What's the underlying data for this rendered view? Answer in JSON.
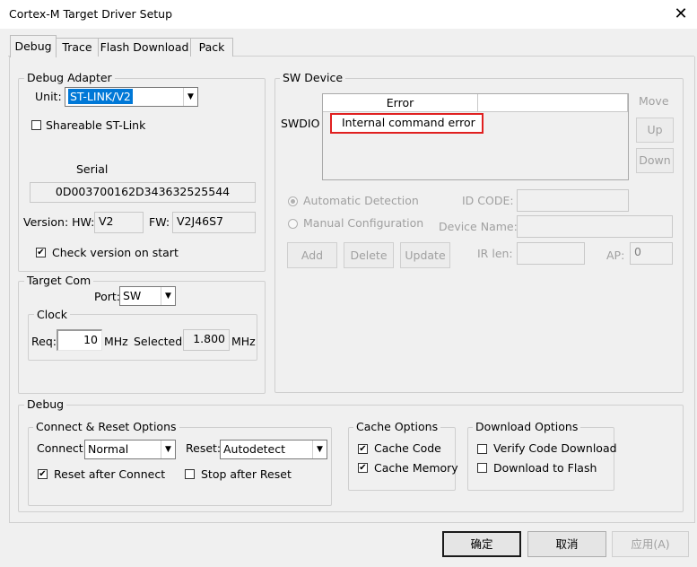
{
  "window": {
    "title": "Cortex-M Target Driver Setup",
    "close": "✕"
  },
  "tabs": [
    {
      "label": "Debug"
    },
    {
      "label": "Trace"
    },
    {
      "label": "Flash Download"
    },
    {
      "label": "Pack"
    }
  ],
  "debug_adapter": {
    "title": "Debug Adapter",
    "unit_label": "Unit:",
    "unit_value": "ST-LINK/V2",
    "shareable_label": "Shareable ST-Link",
    "shareable_checked": false,
    "serial_label": "Serial",
    "serial_value": "0D003700162D343632525544",
    "version_label": "Version: HW:",
    "hw_value": "V2",
    "fw_label": "FW:",
    "fw_value": "V2J46S7",
    "check_version_label": "Check version on start",
    "check_version_checked": true
  },
  "target_com": {
    "title": "Target Com",
    "port_label": "Port:",
    "port_value": "SW",
    "clock": {
      "title": "Clock",
      "req_label": "Req:",
      "req_value": "10",
      "req_unit": "MHz",
      "selected_label": "Selected:",
      "selected_value": "1.800",
      "selected_unit": "MHz"
    }
  },
  "sw_device": {
    "title": "SW Device",
    "column_header": "Error",
    "row_label": "SWDIO",
    "row_value": "Internal command error",
    "move_label": "Move",
    "up_label": "Up",
    "down_label": "Down",
    "auto_detect_label": "Automatic Detection",
    "manual_config_label": "Manual Configuration",
    "id_code_label": "ID CODE:",
    "device_name_label": "Device Name:",
    "ir_len_label": "IR len:",
    "ap_label": "AP:",
    "ap_value": "0",
    "add_label": "Add",
    "delete_label": "Delete",
    "update_label": "Update"
  },
  "debug_section": {
    "title": "Debug",
    "connect_reset": {
      "title": "Connect & Reset Options",
      "connect_label": "Connect:",
      "connect_value": "Normal",
      "reset_label": "Reset:",
      "reset_value": "Autodetect",
      "reset_after_connect_label": "Reset after Connect",
      "stop_after_reset_label": "Stop after Reset"
    },
    "cache": {
      "title": "Cache Options",
      "cache_code_label": "Cache Code",
      "cache_memory_label": "Cache Memory"
    },
    "download": {
      "title": "Download Options",
      "verify_label": "Verify Code Download",
      "download_flash_label": "Download to Flash"
    }
  },
  "buttons": {
    "ok": "确定",
    "cancel": "取消",
    "apply": "应用(A)"
  }
}
